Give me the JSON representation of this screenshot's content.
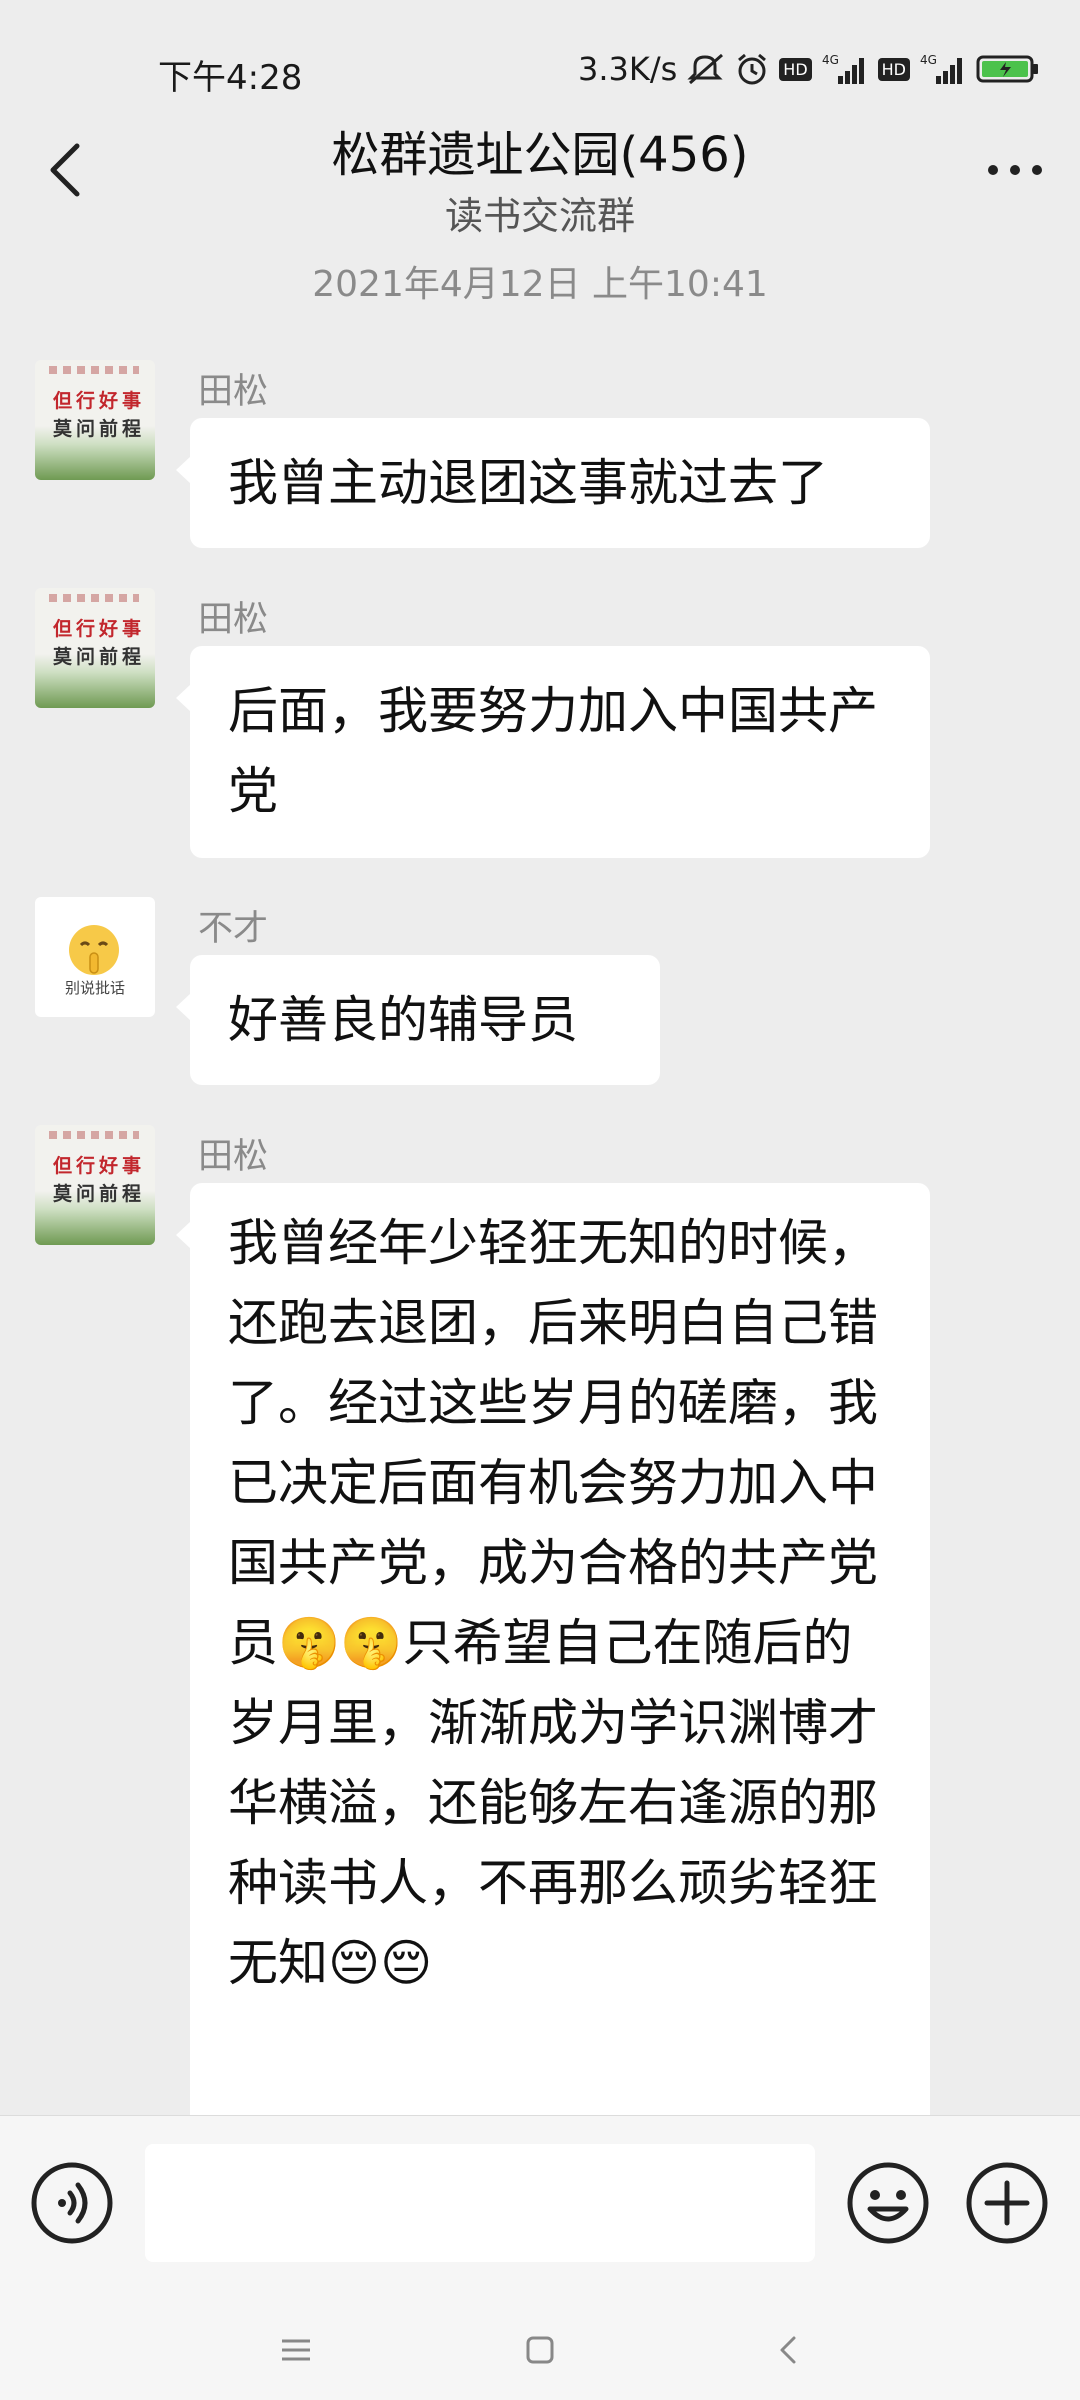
{
  "status_bar": {
    "time": "下午4:28",
    "network_speed": "3.3K/s",
    "signal1_label": "4G",
    "signal2_label": "4G",
    "hd1": "HD",
    "hd2": "HD"
  },
  "header": {
    "title": "松群遗址公园(456)",
    "subtitle": "读书交流群"
  },
  "timestamp": "2021年4月12日 上午10:41",
  "avatars": {
    "calligraphy_line1": "但行好事",
    "calligraphy_line2": "莫问前程",
    "emoji_caption": "别说批话"
  },
  "messages": [
    {
      "sender": "田松",
      "text": "我曾主动退团这事就过去了"
    },
    {
      "sender": "田松",
      "text": "后面，我要努力加入中国共产党"
    },
    {
      "sender": "不才",
      "text": "好善良的辅导员"
    },
    {
      "sender": "田松",
      "text_part1": "我曾经年少轻狂无知的时候，还跑去退团，后来明白自己错了。经过这些岁月的磋磨，我已决定后面有机会努力加入中国共产党，成为合格的共产党员",
      "emoji_shush": "🤫🤫",
      "text_part2": "只希望自己在随后的岁月里，渐渐成为学识渊博才华横溢，还能够左右逢源的那种读书人，不再那么顽劣轻狂无知",
      "emoji_pensive": "😔😔"
    }
  ],
  "input": {
    "placeholder": ""
  },
  "icons": {
    "back": "back-chevron-icon",
    "more": "more-dots-icon",
    "voice": "voice-icon",
    "emoji": "emoji-face-icon",
    "add": "plus-icon",
    "nav_menu": "menu-icon",
    "nav_home": "home-square-icon",
    "nav_back": "nav-back-icon"
  }
}
